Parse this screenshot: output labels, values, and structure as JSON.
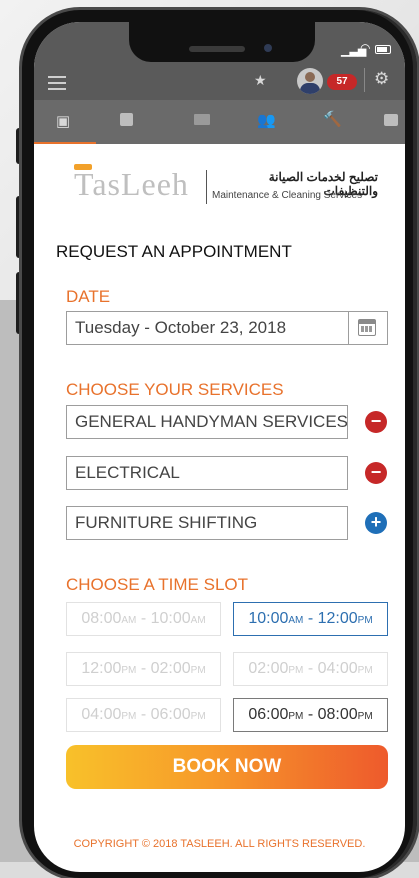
{
  "status_bar": {
    "badge_count": "57"
  },
  "brand": {
    "logo_text": "TasLeeh",
    "arabic_tagline": "تصليح لخدمات الصيانة والتنظيفات",
    "english_tagline": "Maintenance & Cleaning Services"
  },
  "page_title": "REQUEST AN APPOINTMENT",
  "date_section": {
    "label": "DATE",
    "value": "Tuesday - October 23, 2018"
  },
  "services_section": {
    "label": "CHOOSE YOUR SERVICES",
    "items": [
      {
        "value": "GENERAL HANDYMAN SERVICES",
        "action": "remove"
      },
      {
        "value": "ELECTRICAL",
        "action": "remove"
      },
      {
        "value": "FURNITURE SHIFTING",
        "action": "add"
      }
    ]
  },
  "time_section": {
    "label": "CHOOSE A TIME SLOT",
    "slots": [
      {
        "start": "08:00",
        "start_ap": "AM",
        "end": "10:00",
        "end_ap": "AM",
        "state": "disabled"
      },
      {
        "start": "10:00",
        "start_ap": "AM",
        "end": "12:00",
        "end_ap": "PM",
        "state": "selected"
      },
      {
        "start": "12:00",
        "start_ap": "PM",
        "end": "02:00",
        "end_ap": "PM",
        "state": "disabled"
      },
      {
        "start": "02:00",
        "start_ap": "PM",
        "end": "04:00",
        "end_ap": "PM",
        "state": "disabled"
      },
      {
        "start": "04:00",
        "start_ap": "PM",
        "end": "06:00",
        "end_ap": "PM",
        "state": "disabled"
      },
      {
        "start": "06:00",
        "start_ap": "PM",
        "end": "08:00",
        "end_ap": "PM",
        "state": "available"
      }
    ]
  },
  "book_button": "BOOK NOW",
  "footer": "COPYRIGHT © 2018 TASLEEH. ALL RIGHTS RESERVED.",
  "colors": {
    "accent": "#e8722c",
    "selected": "#2d6fb0",
    "remove": "#c62828",
    "add": "#1f6fb8"
  }
}
